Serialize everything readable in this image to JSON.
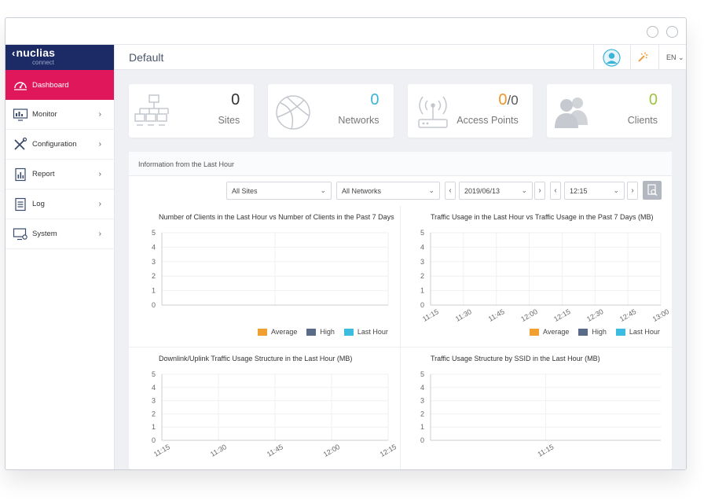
{
  "app": {
    "logo_main": "nuclias",
    "logo_sub": "connect",
    "header_title": "Default",
    "language": "EN"
  },
  "sidebar": {
    "items": [
      {
        "label": "Dashboard",
        "icon": "dashboard-gauge-icon",
        "active": true
      },
      {
        "label": "Monitor",
        "icon": "monitor-chart-icon"
      },
      {
        "label": "Configuration",
        "icon": "wrench-screwdriver-icon"
      },
      {
        "label": "Report",
        "icon": "report-document-icon"
      },
      {
        "label": "Log",
        "icon": "log-list-icon"
      },
      {
        "label": "System",
        "icon": "system-monitor-gear-icon"
      }
    ]
  },
  "summary": [
    {
      "label": "Sites",
      "value": "0",
      "icon": "sites-hierarchy-icon",
      "color": "#333333"
    },
    {
      "label": "Networks",
      "value": "0",
      "icon": "globe-icon",
      "color": "#3bb4d6"
    },
    {
      "label": "Access Points",
      "value_online": "0",
      "value_sep": "/",
      "value_total": "0",
      "icon": "access-point-router-icon",
      "color": "#f0932a"
    },
    {
      "label": "Clients",
      "value": "0",
      "icon": "clients-users-icon",
      "color": "#9cc43f"
    }
  ],
  "panel": {
    "title": "Information from the Last Hour",
    "filters": {
      "sites": "All Sites",
      "networks": "All Networks",
      "date": "2019/06/13",
      "time": "12:15",
      "prev": "‹",
      "next": "›"
    }
  },
  "colors": {
    "average": "#f0a030",
    "high": "#5a6b8a",
    "last_hour": "#3bbce0",
    "active_nav": "#e0175a",
    "logo_bg": "#1c2b66"
  },
  "legend": [
    "Average",
    "High",
    "Last Hour"
  ],
  "chart_data": [
    {
      "type": "bar",
      "title": "Number of Clients in the Last Hour vs Number of Clients in the Past 7 Days",
      "y_ticks": [
        "5",
        "4",
        "3",
        "2",
        "1",
        "0"
      ],
      "ylim": [
        0,
        5
      ],
      "categories": [],
      "series": [
        {
          "name": "Average",
          "values": []
        },
        {
          "name": "High",
          "values": []
        },
        {
          "name": "Last Hour",
          "values": []
        }
      ],
      "legend_position": "bottom-right"
    },
    {
      "type": "bar",
      "title": "Traffic Usage in the Last Hour vs Traffic Usage in the Past 7 Days (MB)",
      "y_ticks": [
        "5",
        "4",
        "3",
        "2",
        "1",
        "0"
      ],
      "ylim": [
        0,
        5
      ],
      "categories": [
        "11:15",
        "11:30",
        "11:45",
        "12:00",
        "12:15",
        "12:30",
        "12:45",
        "13:00"
      ],
      "series": [
        {
          "name": "Average",
          "values": []
        },
        {
          "name": "High",
          "values": []
        },
        {
          "name": "Last Hour",
          "values": []
        }
      ],
      "legend_position": "bottom-right"
    },
    {
      "type": "line",
      "title": "Downlink/Uplink Traffic Usage Structure in the Last Hour (MB)",
      "y_ticks": [
        "5",
        "4",
        "3",
        "2",
        "1",
        "0"
      ],
      "ylim": [
        0,
        5
      ],
      "categories": [
        "11:15",
        "11:30",
        "11:45",
        "12:00",
        "12:15"
      ],
      "series": []
    },
    {
      "type": "line",
      "title": "Traffic Usage Structure by SSID in the Last Hour (MB)",
      "y_ticks": [
        "5",
        "4",
        "3",
        "2",
        "1",
        "0"
      ],
      "ylim": [
        0,
        5
      ],
      "categories": [
        "11:15"
      ],
      "series": []
    }
  ]
}
